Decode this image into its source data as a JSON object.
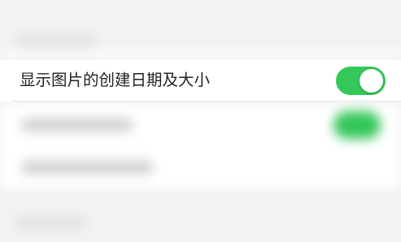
{
  "settings": {
    "row": {
      "label": "显示图片的创建日期及大小",
      "toggle_on": true
    }
  },
  "colors": {
    "toggle_on": "#34c759",
    "row_background": "#ffffff",
    "page_background": "#f2f2f2",
    "label_text": "#222222"
  }
}
